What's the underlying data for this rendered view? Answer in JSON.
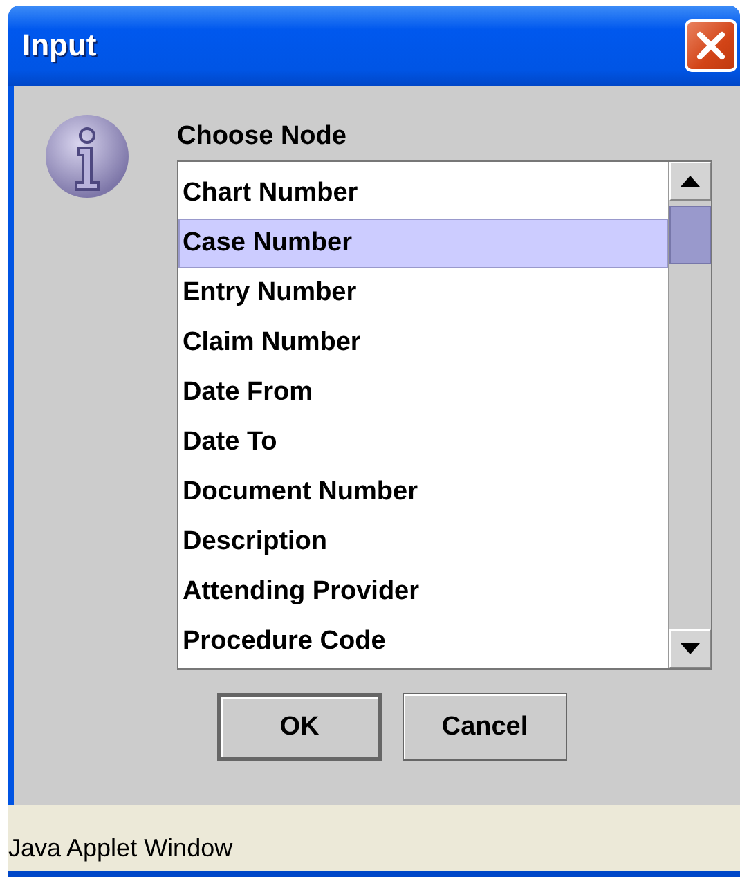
{
  "window": {
    "title": "Input"
  },
  "prompt": "Choose Node",
  "list": {
    "items": [
      {
        "label": "Chart Number",
        "selected": false
      },
      {
        "label": "Case Number",
        "selected": true
      },
      {
        "label": "Entry Number",
        "selected": false
      },
      {
        "label": "Claim Number",
        "selected": false
      },
      {
        "label": "Date From",
        "selected": false
      },
      {
        "label": "Date To",
        "selected": false
      },
      {
        "label": "Document Number",
        "selected": false
      },
      {
        "label": "Description",
        "selected": false
      },
      {
        "label": "Attending Provider",
        "selected": false
      },
      {
        "label": "Procedure Code",
        "selected": false
      }
    ]
  },
  "buttons": [
    {
      "label": "OK",
      "default": true
    },
    {
      "label": "Cancel",
      "default": false
    }
  ],
  "status_bar": "Java Applet Window"
}
